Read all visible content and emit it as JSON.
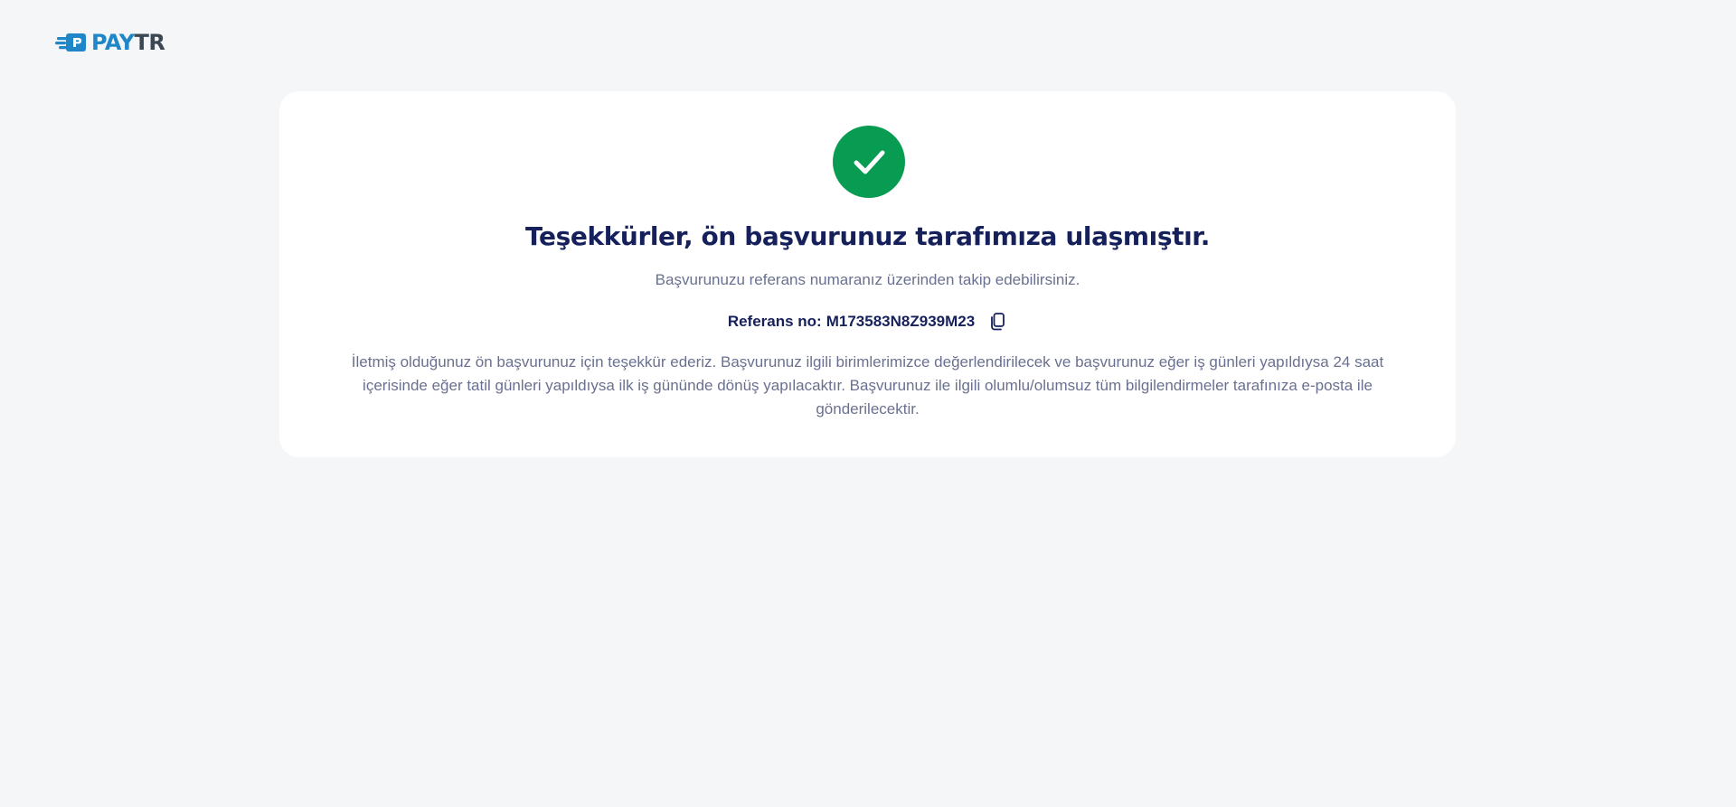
{
  "header": {
    "logo_pay": "PAY",
    "logo_tr": "TR"
  },
  "card": {
    "title": "Teşekkürler, ön başvurunuz tarafımıza ulaşmıştır.",
    "subtitle": "Başvurunuzu referans numaranız üzerinden takip edebilirsiniz.",
    "reference_label": "Referans no:",
    "reference_value": "M173583N8Z939M23",
    "info_text": "İletmiş olduğunuz ön başvurunuz için teşekkür ederiz. Başvurunuz ilgili birimlerimizce değerlendirilecek ve başvurunuz eğer iş günleri yapıldıysa 24 saat içerisinde eğer tatil günleri yapıldıysa ilk iş gününde dönüş yapılacaktır. Başvurunuz ile ilgili olumlu/olumsuz tüm bilgilendirmeler tarafınıza e-posta ile gönderilecektir."
  },
  "icons": {
    "success": "check-circle-icon",
    "copy": "copy-icon"
  },
  "colors": {
    "success_green": "#079c52",
    "title_navy": "#16215c",
    "body_text": "#6a7190",
    "logo_blue": "#1f86c7",
    "logo_gray": "#3b4753",
    "page_bg": "#f5f6f8"
  }
}
